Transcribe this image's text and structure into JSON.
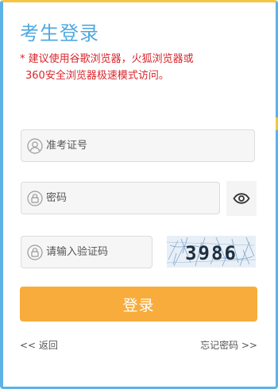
{
  "form": {
    "title": "考生登录",
    "notice_line1": "* 建议使用谷歌浏览器，火狐浏览器或",
    "notice_line2": "360安全浏览器极速模式访问。",
    "exam_id_placeholder": "准考证号",
    "password_placeholder": "密码",
    "captcha_placeholder": "请输入验证码",
    "captcha_code": "3986",
    "login_label": "登录",
    "back_label": "<< 返回",
    "forgot_label": "忘记密码 >>"
  },
  "icons": {
    "user": "user-icon",
    "lock": "lock-icon",
    "eye": "eye-icon"
  },
  "colors": {
    "accent_blue": "#52a9df",
    "frame_blue": "#5db2e6",
    "frame_gold": "#f3c542",
    "notice_red": "#d9262c",
    "button_orange": "#f8ac3b"
  }
}
